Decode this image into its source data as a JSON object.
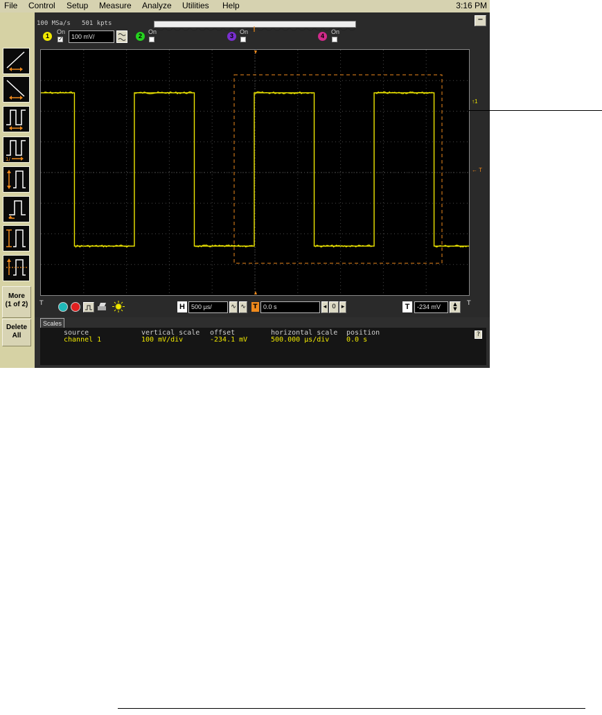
{
  "menu": [
    "File",
    "Control",
    "Setup",
    "Measure",
    "Analyze",
    "Utilities",
    "Help"
  ],
  "clock": "3:16 PM",
  "acquisition": {
    "sample_rate": "100 MSa/s",
    "memory_depth": "501 kpts"
  },
  "channels": [
    {
      "number": "1",
      "on_label": "On",
      "checked": true,
      "scale": "100 mV/",
      "color": "#f0e800"
    },
    {
      "number": "2",
      "on_label": "On",
      "checked": false,
      "color": "#25d21e"
    },
    {
      "number": "3",
      "on_label": "On",
      "checked": false,
      "color": "#7a2fd0"
    },
    {
      "number": "4",
      "on_label": "On",
      "checked": false,
      "color": "#d02a8a"
    }
  ],
  "toolbar": {
    "more_label_1": "More",
    "more_label_2": "(1 of 2)",
    "delete_label_1": "Delete",
    "delete_label_2": "All"
  },
  "horizontal": {
    "tag": "H",
    "scale": "500 µs/",
    "position_tag": "T",
    "delay": "0.0 s",
    "zero_btn": "0"
  },
  "trigger": {
    "tag": "T",
    "level": "-234 mV",
    "right_marker": "T"
  },
  "graticule_markers": {
    "ch1_ground": "1",
    "trigger_level": "T"
  },
  "measurements_tab": "Scales",
  "measurements": {
    "headers": [
      "source",
      "vertical scale",
      "offset",
      "horizontal scale",
      "position"
    ],
    "values": [
      "channel 1",
      "100 mV/div",
      "-234.1 mV",
      "500.000 µs/div",
      "0.0 s"
    ]
  },
  "help_label": "?",
  "minimize_label": "−",
  "waveform": {
    "type": "square",
    "high_level_div": 2.6,
    "low_level_div": -2.4,
    "period_div": 2.0,
    "duty": 0.5,
    "color": "#f0e800"
  },
  "colors": {
    "accent_orange": "#f08a1c",
    "screen_bg": "#000000",
    "frame_bg": "#d4cfa0"
  }
}
